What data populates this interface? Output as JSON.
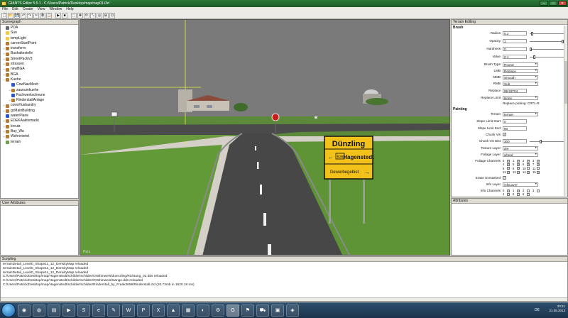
{
  "window": {
    "title": "GIANTS Editor 5.5.1 - C:/Users/Patrick/Desktop/map/map01.i3d",
    "minimize_glyph": "–",
    "maximize_glyph": "□",
    "close_glyph": "✕"
  },
  "menu": [
    "File",
    "Edit",
    "Create",
    "View",
    "Window",
    "Help"
  ],
  "toolbar_glyphs": [
    "🗋",
    "📂",
    "💾",
    "↶",
    "↷",
    "✂",
    "⧉",
    "📋",
    "▶",
    "■",
    "⬚",
    "✥",
    "⟳",
    "⤡",
    "◎",
    "⊞",
    "⊡"
  ],
  "scenegraph": {
    "title": "Scenegraph",
    "items": [
      {
        "label": "PDA",
        "icon": "camera-icon",
        "exp": ""
      },
      {
        "label": "Sun",
        "icon": "light-icon",
        "exp": ""
      },
      {
        "label": "tempLight",
        "icon": "light-icon",
        "exp": ""
      },
      {
        "label": "careerStartPoint",
        "icon": "transform-icon",
        "exp": ""
      },
      {
        "label": "transform",
        "icon": "transform-icon",
        "exp": "+"
      },
      {
        "label": "Bushaltestelle",
        "icon": "transform-icon",
        "exp": "+"
      },
      {
        "label": "StreetPackV3",
        "icon": "transform-icon",
        "exp": "+"
      },
      {
        "label": "strassen",
        "icon": "transform-icon",
        "exp": "+"
      },
      {
        "label": "newBGA",
        "icon": "transform-icon",
        "exp": "+"
      },
      {
        "label": "BGA",
        "icon": "transform-icon",
        "exp": "+"
      },
      {
        "label": "Kuehe",
        "icon": "transform-icon",
        "exp": "−"
      },
      {
        "label": "  CowNavMesh",
        "icon": "shape-icon",
        "exp": ""
      },
      {
        "label": "  zaunumkuehe",
        "icon": "transform-icon",
        "exp": "+"
      },
      {
        "label": "  Fachwerkscheune",
        "icon": "shape-icon",
        "exp": ""
      },
      {
        "label": "  RinderstallAnlage",
        "icon": "transform-icon",
        "exp": "+"
      },
      {
        "label": "cowsHusbandry",
        "icon": "transform-icon",
        "exp": "+"
      },
      {
        "label": "gcMainBuilding",
        "icon": "transform-icon",
        "exp": "+"
      },
      {
        "label": "waterPlane",
        "icon": "shape-icon",
        "exp": ""
      },
      {
        "label": "EDEKAaktivmarkt",
        "icon": "transform-icon",
        "exp": "+"
      },
      {
        "label": "kreutz",
        "icon": "transform-icon",
        "exp": "+"
      },
      {
        "label": "Bay_Wa",
        "icon": "transform-icon",
        "exp": "+"
      },
      {
        "label": "Wohnviertel",
        "icon": "transform-icon",
        "exp": "+"
      },
      {
        "label": "terrain",
        "icon": "terrain-icon",
        "exp": ""
      }
    ]
  },
  "user_attributes": {
    "title": "User Attributes"
  },
  "viewport": {
    "sign_town": "Dünzling",
    "sign_destination": "Hagenstedt",
    "sign_destination_prefix": "B36",
    "sign_third": "Gewerbegebiet",
    "corner_label": "Pers",
    "sign_colors": {
      "board": "#f2c21b",
      "text": "#111111",
      "stop": "#c81e1e"
    }
  },
  "terrain_editing": {
    "title": "Terrain Editing",
    "brush_section": "Brush",
    "radius_label": "Radius",
    "radius_value": "5.2",
    "radius_level": 0.05,
    "opacity_label": "Opacity",
    "opacity_value": "1",
    "opacity_level": 1.0,
    "hardness_label": "Hardness",
    "hardness_value": "0",
    "hardness_level": 0.0,
    "value_label": "Value",
    "value_value": "0.1",
    "value_level": 0.1,
    "brush_type_label": "Brush Type",
    "brush_type_value": "Round",
    "lmb_label": "LMB",
    "lmb_value": "Replace",
    "mmb_label": "MMB",
    "mmb_value": "Smooth",
    "rmb_label": "RMB",
    "rmb_value": "Sub",
    "replace_label": "Replace",
    "replace_value": "99.93704",
    "replace_limit_label": "Replace Limit",
    "replace_limit_value": "None",
    "replace_picking": "Replace picking: CRTL-R",
    "painting_section": "Painting",
    "terrain_label": "Terrain",
    "terrain_value": "terrain",
    "slope_start_label": "Slope Limit Start",
    "slope_start_value": "0",
    "slope_end_label": "Slope Limit End",
    "slope_end_value": "90",
    "chunk_vis_label": "Chunk Vis",
    "chunk_vis_mark": "✓",
    "chunk_vis_dist_label": "Chunk Vis Dist",
    "chunk_vis_dist_value": "300",
    "chunk_vis_dist_level": 0.3,
    "texture_layer_label": "Texture Layer",
    "texture_layer_value": "dirt",
    "foliage_layer_label": "Foliage Layer",
    "foliage_layer_value": "wheat",
    "foliage_channels_label": "Foliage Channels",
    "foliage_channels": [
      "0",
      "1",
      "2",
      "3",
      "4",
      "5",
      "6",
      "7",
      "8",
      "9",
      "10",
      "11",
      "12",
      "13",
      "14",
      "15"
    ],
    "foliage_checked": [
      0,
      1,
      2,
      3,
      4,
      5,
      6,
      7,
      8,
      9,
      12,
      13,
      14,
      15
    ],
    "erase_unmasked_label": "Erase Unmasked",
    "erase_unmasked_mark": "✓",
    "info_layer_label": "Info Layer",
    "info_layer_value": "infoLayer",
    "info_channels_label": "Info Channels",
    "info_channels": [
      "0",
      "1",
      "2",
      "3",
      "4",
      "5",
      "6"
    ],
    "info_checked": [
      0,
      1
    ]
  },
  "attributes": {
    "title": "Attributes"
  },
  "scripting": {
    "title": "Scripting",
    "lines": [
      "terrainDetail_Level0_Shape11_12_DensityMap reloaded",
      "terrainDetail_Level0_Shape11_12_DensityMap reloaded",
      "terrainDetail_Level0_Shape11_12_DensityMap reloaded",
      "C:/Users/Patrick/Desktop/map/Hagenstedt/schilder/schilder/Ortshinweis/duenzling/Richtung_02.dds reloaded",
      "C:/Users/Patrick/Desktop/map/Hagenstedt/schilder/schilder/Ortshinweis/stange.dds reloaded",
      "C:/Users/Patrick/Desktop/map/Hagenstedt/schilder/schilder/Rinderstall_by_Freak3659/Rinderstall.i3d (20.73mb in 1620.18 ms)"
    ]
  },
  "taskbar": {
    "apps": [
      {
        "name": "chrome-taskbar-icon",
        "glyph": "◉"
      },
      {
        "name": "firefox-taskbar-icon",
        "glyph": "◍"
      },
      {
        "name": "explorer-taskbar-icon",
        "glyph": "▤"
      },
      {
        "name": "media-taskbar-icon",
        "glyph": "▶"
      },
      {
        "name": "skype-taskbar-icon",
        "glyph": "S"
      },
      {
        "name": "ie-taskbar-icon",
        "glyph": "e"
      },
      {
        "name": "paint-taskbar-icon",
        "glyph": "✎"
      },
      {
        "name": "word-taskbar-icon",
        "glyph": "W"
      },
      {
        "name": "ps-taskbar-icon",
        "glyph": "P"
      },
      {
        "name": "excel-taskbar-icon",
        "glyph": "X"
      },
      {
        "name": "vlc-taskbar-icon",
        "glyph": "▲"
      },
      {
        "name": "winrar-taskbar-icon",
        "glyph": "▦"
      },
      {
        "name": "gimp-taskbar-icon",
        "glyph": "◐"
      },
      {
        "name": "tool-taskbar-icon",
        "glyph": "⚙"
      },
      {
        "name": "giants-taskbar-icon",
        "glyph": "G"
      },
      {
        "name": "game-taskbar-icon",
        "glyph": "⚑"
      },
      {
        "name": "tractor-taskbar-icon",
        "glyph": "⛟"
      },
      {
        "name": "farm-taskbar-icon",
        "glyph": "▣"
      },
      {
        "name": "misc-taskbar-icon",
        "glyph": "◈"
      }
    ],
    "lang": "DE",
    "time": "20:21",
    "date": "21.05.2013"
  }
}
